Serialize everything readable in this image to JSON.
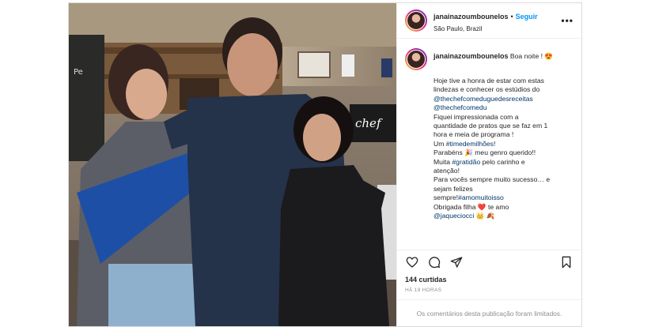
{
  "header": {
    "username": "janainazoumbounelos",
    "separator": "•",
    "follow_label": "Seguir",
    "location": "São Paulo, Brazil",
    "more_icon": "more-horizontal-icon"
  },
  "photo": {
    "sign_text": "The chef"
  },
  "caption": {
    "username": "janainazoumbounelos",
    "first_line": "Boa noite ! 😍",
    "lines": [
      [
        {
          "t": "Hoje tive a honra de estar com estas"
        }
      ],
      [
        {
          "t": "lindezas e conhecer os estúdios do"
        }
      ],
      [
        {
          "t": "@thechefcomeduguedesreceitas",
          "link": true
        }
      ],
      [
        {
          "t": "@thechefcomedu",
          "link": true
        }
      ],
      [
        {
          "t": "Fiquei impressionada com a"
        }
      ],
      [
        {
          "t": "quantidade de pratos que se faz em 1"
        }
      ],
      [
        {
          "t": "hora e meia de programa !"
        }
      ],
      [
        {
          "t": "Um "
        },
        {
          "t": "#timedemilhões",
          "link": true
        },
        {
          "t": "!"
        }
      ],
      [
        {
          "t": "Parabéns 🎉 meu genro querido!!"
        }
      ],
      [
        {
          "t": "Muita "
        },
        {
          "t": "#gratidão",
          "link": true
        },
        {
          "t": " pelo carinho e"
        }
      ],
      [
        {
          "t": "atenção!"
        }
      ],
      [
        {
          "t": "Para vocês sempre muito sucesso… e"
        }
      ],
      [
        {
          "t": "sejam felizes"
        }
      ],
      [
        {
          "t": "sempre!"
        },
        {
          "t": "#amomuitoisso",
          "link": true
        }
      ],
      [
        {
          "t": "Obrigada filha ❤️ te amo"
        }
      ],
      [
        {
          "t": "@jaquecіocci",
          "link": true
        },
        {
          "t": " 👑 🍂"
        }
      ]
    ]
  },
  "actions": {
    "like_icon": "heart-icon",
    "comment_icon": "comment-icon",
    "share_icon": "share-icon",
    "save_icon": "bookmark-icon"
  },
  "likes_text": "144 curtidas",
  "time_text": "HÁ 19 HORAS",
  "comments_limited_text": "Os comentários desta publicação foram limitados."
}
